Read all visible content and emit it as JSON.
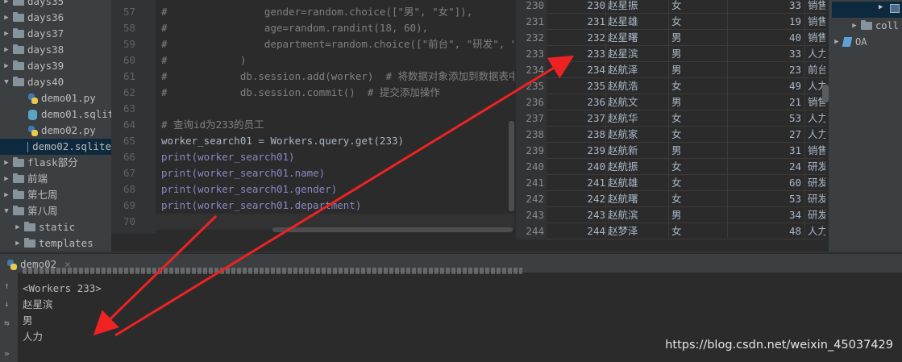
{
  "project_tree": {
    "items": [
      {
        "label": "days35",
        "type": "folder",
        "expanded": false
      },
      {
        "label": "days36",
        "type": "folder",
        "expanded": false
      },
      {
        "label": "days37",
        "type": "folder",
        "expanded": false
      },
      {
        "label": "days38",
        "type": "folder",
        "expanded": false
      },
      {
        "label": "days39",
        "type": "folder",
        "expanded": false
      },
      {
        "label": "days40",
        "type": "folder",
        "expanded": true
      },
      {
        "label": "demo01.py",
        "type": "python"
      },
      {
        "label": "demo01.sqlite",
        "type": "sqlite"
      },
      {
        "label": "demo02.py",
        "type": "python"
      },
      {
        "label": "demo02.sqlite",
        "type": "sqlite",
        "selected": true
      },
      {
        "label": "flask部分",
        "type": "folder",
        "expanded": false
      },
      {
        "label": "前端",
        "type": "folder",
        "expanded": false
      },
      {
        "label": "第七周",
        "type": "folder",
        "expanded": false
      },
      {
        "label": "第八周",
        "type": "folder",
        "expanded": true
      },
      {
        "label": "static",
        "type": "folder",
        "expanded": false
      },
      {
        "label": "templates",
        "type": "folder",
        "expanded": false
      }
    ]
  },
  "editor": {
    "lines": [
      {
        "num": "57",
        "text": "#                gender=random.choice([\"男\", \"女\"]),"
      },
      {
        "num": "58",
        "text": "#                age=random.randint(18, 60),"
      },
      {
        "num": "59",
        "text": "#                department=random.choice([\"前台\", \"研发\", \"人力"
      },
      {
        "num": "60",
        "text": "#            )"
      },
      {
        "num": "61",
        "text": "#            db.session.add(worker)  # 将数据对象添加到数据表中"
      },
      {
        "num": "62",
        "text": "#            db.session.commit()  # 提交添加操作"
      },
      {
        "num": "63",
        "text": ""
      },
      {
        "num": "64",
        "text": "# 查询id为233的员工"
      },
      {
        "num": "65",
        "text": "worker_search01 = Workers.query.get(233)"
      },
      {
        "num": "66",
        "text": "print(worker_search01)"
      },
      {
        "num": "67",
        "text": "print(worker_search01.name)"
      },
      {
        "num": "68",
        "text": "print(worker_search01.gender)"
      },
      {
        "num": "69",
        "text": "print(worker_search01.department)"
      },
      {
        "num": "70",
        "text": ""
      }
    ]
  },
  "table": {
    "rows": [
      {
        "row": "230",
        "id": "230",
        "name": "赵星振",
        "gender": "女",
        "age": "33",
        "department": "销售"
      },
      {
        "row": "231",
        "id": "231",
        "name": "赵星雄",
        "gender": "女",
        "age": "19",
        "department": "销售"
      },
      {
        "row": "232",
        "id": "232",
        "name": "赵星曙",
        "gender": "男",
        "age": "40",
        "department": "销售"
      },
      {
        "row": "233",
        "id": "233",
        "name": "赵星滨",
        "gender": "男",
        "age": "33",
        "department": "人力"
      },
      {
        "row": "234",
        "id": "234",
        "name": "赵航泽",
        "gender": "男",
        "age": "23",
        "department": "前台"
      },
      {
        "row": "235",
        "id": "235",
        "name": "赵航浩",
        "gender": "女",
        "age": "49",
        "department": "人力"
      },
      {
        "row": "236",
        "id": "236",
        "name": "赵航文",
        "gender": "男",
        "age": "21",
        "department": "销售"
      },
      {
        "row": "237",
        "id": "237",
        "name": "赵航华",
        "gender": "女",
        "age": "53",
        "department": "人力"
      },
      {
        "row": "238",
        "id": "238",
        "name": "赵航家",
        "gender": "女",
        "age": "27",
        "department": "人力"
      },
      {
        "row": "239",
        "id": "239",
        "name": "赵航新",
        "gender": "男",
        "age": "31",
        "department": "销售"
      },
      {
        "row": "240",
        "id": "240",
        "name": "赵航振",
        "gender": "女",
        "age": "24",
        "department": "研发"
      },
      {
        "row": "241",
        "id": "241",
        "name": "赵航雄",
        "gender": "女",
        "age": "60",
        "department": "研发"
      },
      {
        "row": "242",
        "id": "242",
        "name": "赵航曙",
        "gender": "女",
        "age": "53",
        "department": "研发"
      },
      {
        "row": "243",
        "id": "243",
        "name": "赵航滨",
        "gender": "男",
        "age": "34",
        "department": "研发"
      },
      {
        "row": "244",
        "id": "244",
        "name": "赵梦泽",
        "gender": "女",
        "age": "48",
        "department": "人力"
      }
    ]
  },
  "db_panel": {
    "items": [
      {
        "label": "coll",
        "type": "folder"
      },
      {
        "label": "OA",
        "type": "datasource"
      }
    ]
  },
  "run": {
    "tab_label": "demo02",
    "output": [
      "<Workers 233>",
      "赵星滨",
      "男",
      "人力"
    ]
  },
  "watermark": "https://blog.csdn.net/weixin_45037429",
  "colors": {
    "background": "#2b2b2b",
    "panel": "#3c3f41",
    "selection": "#0d293e",
    "arrow": "#ee2222"
  }
}
